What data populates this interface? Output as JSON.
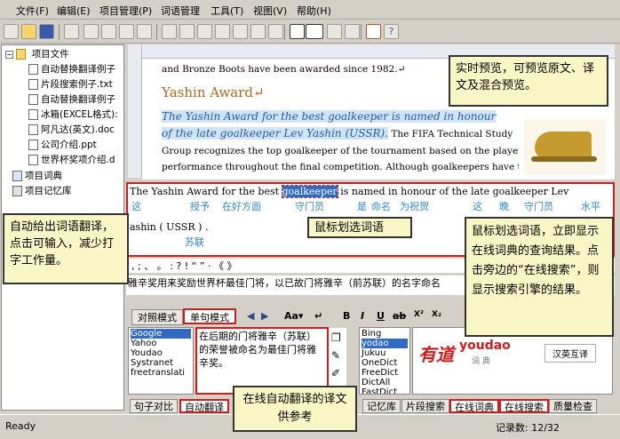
{
  "menubar": {
    "items": [
      "文件(F)",
      "编辑(E)",
      "项目管理(P)",
      "词语管理",
      "工具(T)",
      "视图(V)",
      "帮助(H)"
    ]
  },
  "tree": {
    "root": "项目文件",
    "files": [
      "自动替换翻译例子",
      "片段搜索例子.txt",
      "自动替换翻译例子",
      "冰箱(EXCEL格式):",
      "阿凡达(英文).doc",
      "公司介绍.ppt",
      "世界杯奖项介绍.d"
    ],
    "dict": "项目词典",
    "memory": "项目记忆库"
  },
  "preview": {
    "line1": "and Bronze Boots have been awarded since 1982.↵",
    "heading": "Yashin Award↵",
    "hl1": "The Yashin Award for the best goalkeeper is named in honour",
    "hl2": "of the late goalkeeper Lev Yashin (USSR).",
    "hl2_rest": " The FIFA Technical Study",
    "line5": "Group recognizes the top goalkeeper of the tournament based on the player's",
    "line6": "performance throughout the final competition. Although goalkeepers have this"
  },
  "editor": {
    "source_pre": "The Yashin Award for the best ",
    "source_word": "goalkeeper",
    "source_post": " is named in honour of the late goalkeeper Lev",
    "glosses": [
      "这",
      "授予",
      "在好方面",
      "守门员",
      "是",
      "命名",
      "为祝贺",
      "这",
      "晚",
      "守门员",
      "水平"
    ],
    "source_line2": "ashin ( USSR ) .",
    "gloss2": "苏联",
    "punct": ", ; 、 。 : ? ! “ ” · 《 》",
    "target": "雅辛奖用来奖励世界杯最佳门将，以已故门将雅辛（前苏联）的名字命名"
  },
  "lower": {
    "tabs": [
      "对照模式",
      "单句模式"
    ],
    "engines": [
      "Google",
      "Yahoo",
      "Youdao",
      "Systranet",
      "freetranslati"
    ],
    "translation": "在后期的门将雅辛（苏联）的荣誉被命名为最佳门将雅辛奖。",
    "dicts": [
      "Bing",
      "yodao",
      "Jukuu",
      "OneDict",
      "FreeDict",
      "DictAll",
      "FastDict"
    ],
    "youdao_brand": "有道",
    "youdao_en": "youdao",
    "youdao_sub": "词 典",
    "youdao_btn": "汉英互译"
  },
  "bottom_tabs": {
    "left": [
      "句子对比",
      "自动翻译"
    ],
    "right": [
      "记忆库",
      "片段搜索",
      "在线词典",
      "在线搜索",
      "质量检查"
    ]
  },
  "status": {
    "ready": "Ready",
    "records": "记录数: 12/32"
  },
  "callouts": {
    "preview": "实时预览，可预览原文、译文及混合预览。",
    "mouse": "鼠标划选词语",
    "auto": "自动给出词语翻译，点击可输入，减少打字工作量。",
    "online": "鼠标划选词语，立即显示在线词典的查询结果。点击旁边的“在线搜索”，则显示搜索引擎的结果。",
    "autotrans": "在线自动翻译的译文供参考"
  },
  "colors": {
    "accent_red": "#d11c1c",
    "highlight_blue": "#1f5faa",
    "gloss_blue": "#2f88c8",
    "heading_brown": "#b5651d",
    "callout_bg": "#f8f6c4"
  }
}
